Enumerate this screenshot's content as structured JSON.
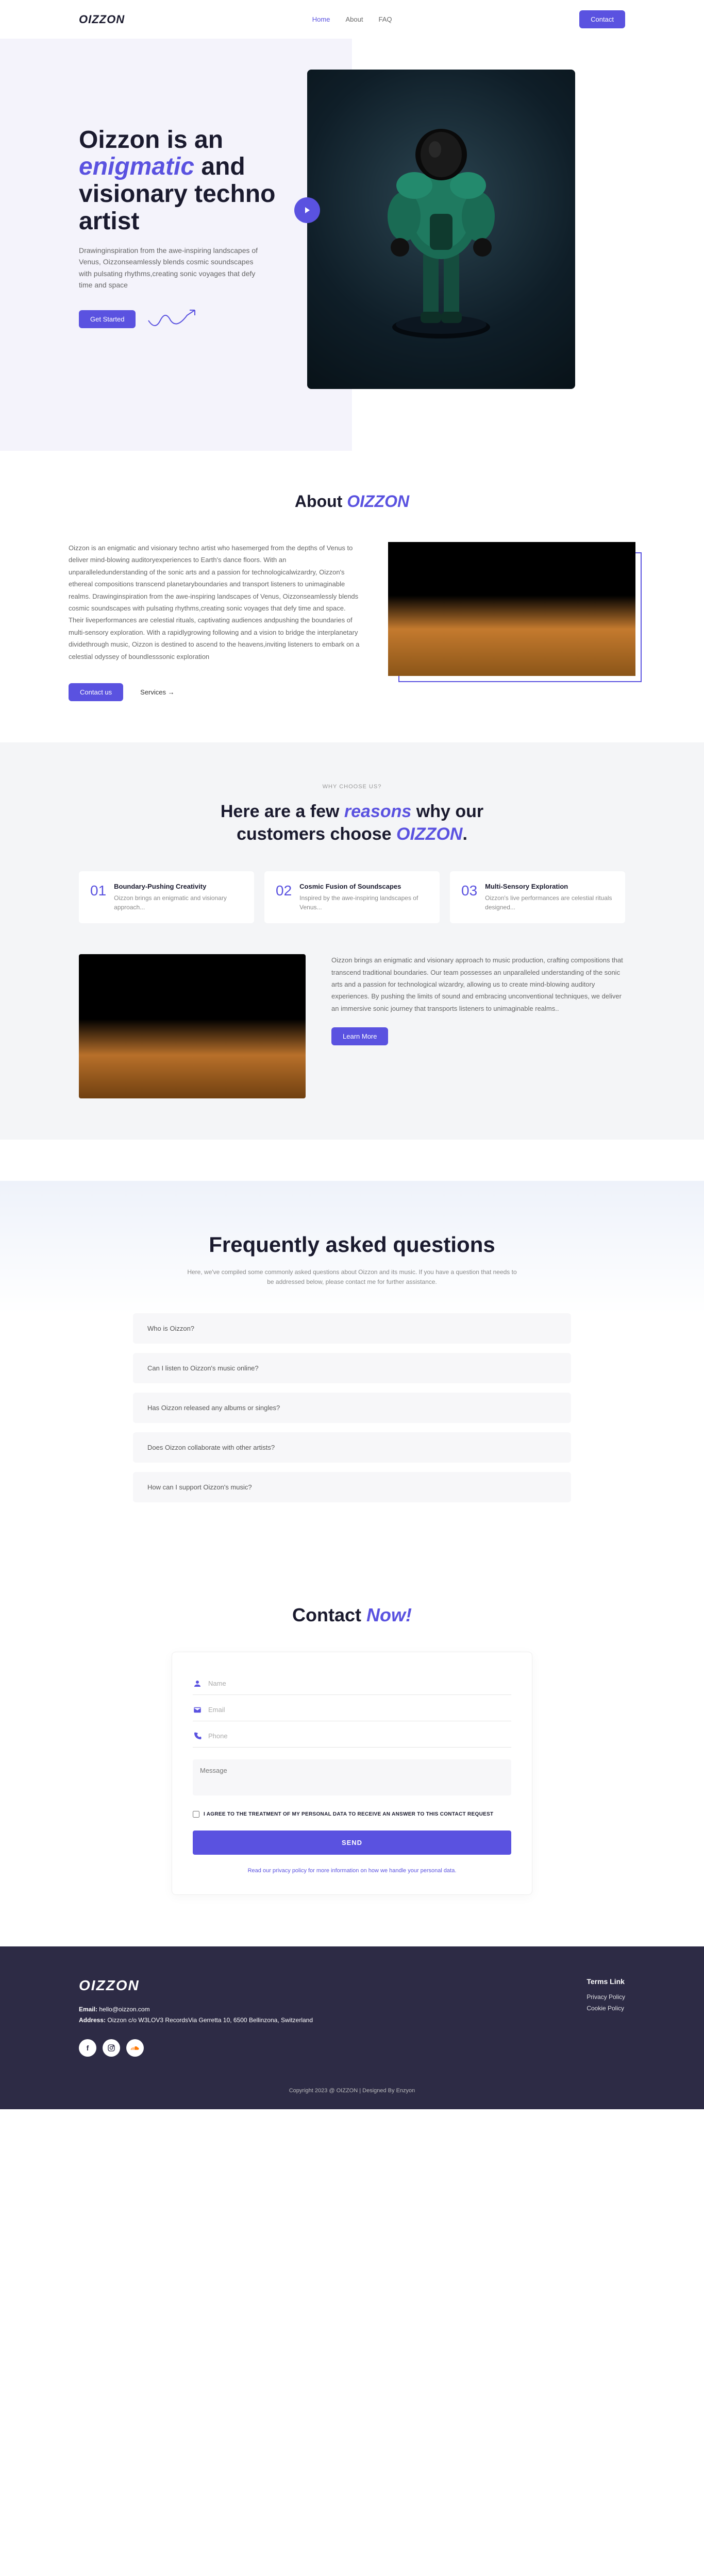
{
  "brand": "OIZZON",
  "nav": {
    "home": "Home",
    "about": "About",
    "faq": "FAQ",
    "contact": "Contact"
  },
  "hero": {
    "title_l1": "Oizzon is an",
    "title_em": "enigmatic",
    "title_l2": " and",
    "title_l3": "visionary techno artist",
    "desc": "Drawinginspiration from the awe-inspiring landscapes of Venus, Oizzonseamlessly blends cosmic soundscapes with pulsating rhythms,creating sonic voyages that defy time and space",
    "cta": "Get Started"
  },
  "about": {
    "title_pre": "About ",
    "brand": "OIZZON",
    "text": "Oizzon is an enigmatic and visionary techno artist who hasemerged from the depths of Venus to deliver mind-blowing auditoryexperiences to Earth's dance floors. With an unparalleledunderstanding of the sonic arts and a passion for technologicalwizardry, Oizzon's ethereal compositions transcend planetaryboundaries and transport listeners to unimaginable realms. Drawinginspiration from the awe-inspiring landscapes of Venus, Oizzonseamlessly blends cosmic soundscapes with pulsating rhythms,creating sonic voyages that defy time and space. Their liveperformances are celestial rituals, captivating audiences andpushing the boundaries of multi-sensory exploration. With a rapidlygrowing following and a vision to bridge the interplanetary dividethrough music, Oizzon is destined to ascend to the heavens,inviting listeners to embark on a celestial odyssey of boundlesssonic exploration",
    "cta1": "Contact us",
    "cta2": "Services →"
  },
  "reasons": {
    "eyebrow": "WHY CHOOSE US?",
    "title_l1": "Here are a few ",
    "title_em": "reasons",
    "title_l2": " why our",
    "title_l3": "customers choose ",
    "title_brand": "OIZZON",
    "dot": ".",
    "cards": [
      {
        "num": "01",
        "head": "Boundary-Pushing Creativity",
        "body": "Oizzon brings an enigmatic and visionary approach..."
      },
      {
        "num": "02",
        "head": "Cosmic Fusion of Soundscapes",
        "body": "Inspired by the awe-inspiring landscapes of Venus..."
      },
      {
        "num": "03",
        "head": "Multi-Sensory Exploration",
        "body": "Oizzon's live performances are celestial rituals designed..."
      }
    ],
    "lower_text": "Oizzon brings an enigmatic and visionary approach to music production, crafting compositions that transcend traditional boundaries. Our team possesses an unparalleled understanding of the sonic arts and a passion for technological wizardry, allowing us to create mind-blowing auditory experiences. By pushing the limits of sound and embracing unconventional techniques, we deliver an immersive sonic journey that transports listeners to unimaginable realms..",
    "cta": "Learn More"
  },
  "faq": {
    "title": "Frequently asked questions",
    "sub": "Here, we've compiled some commonly asked questions about Oizzon and its music. If you have a question that needs to be addressed below, please contact me for further assistance.",
    "items": [
      "Who is Oizzon?",
      "Can I listen to Oizzon's music online?",
      "Has Oizzon released any albums or singles?",
      "Does Oizzon collaborate with other artists?",
      "How can I support Oizzon's music?"
    ]
  },
  "contact": {
    "title_pre": "Contact ",
    "title_em": "Now!",
    "ph_name": "Name",
    "ph_email": "Email",
    "ph_phone": "Phone",
    "ph_message": "Message",
    "consent": "I AGREE TO THE TREATMENT OF MY PERSONAL DATA TO RECEIVE AN ANSWER TO THIS CONTACT REQUEST",
    "send": "SEND",
    "privacy": "Read our privacy policy for more information on how we handle your personal data."
  },
  "footer": {
    "email_label": "Email: ",
    "email": "hello@oizzon.com",
    "address_label": "Address: ",
    "address": "Oizzon c/o W3LOV3 RecordsVia Gerretta 10, 6500 Bellinzona, Switzerland",
    "links_title": "Terms Link",
    "link1": "Privacy Policy",
    "link2": "Cookie Policy",
    "copy": "Copyright 2023 @ OIZZON | Designed By Enzyon"
  }
}
